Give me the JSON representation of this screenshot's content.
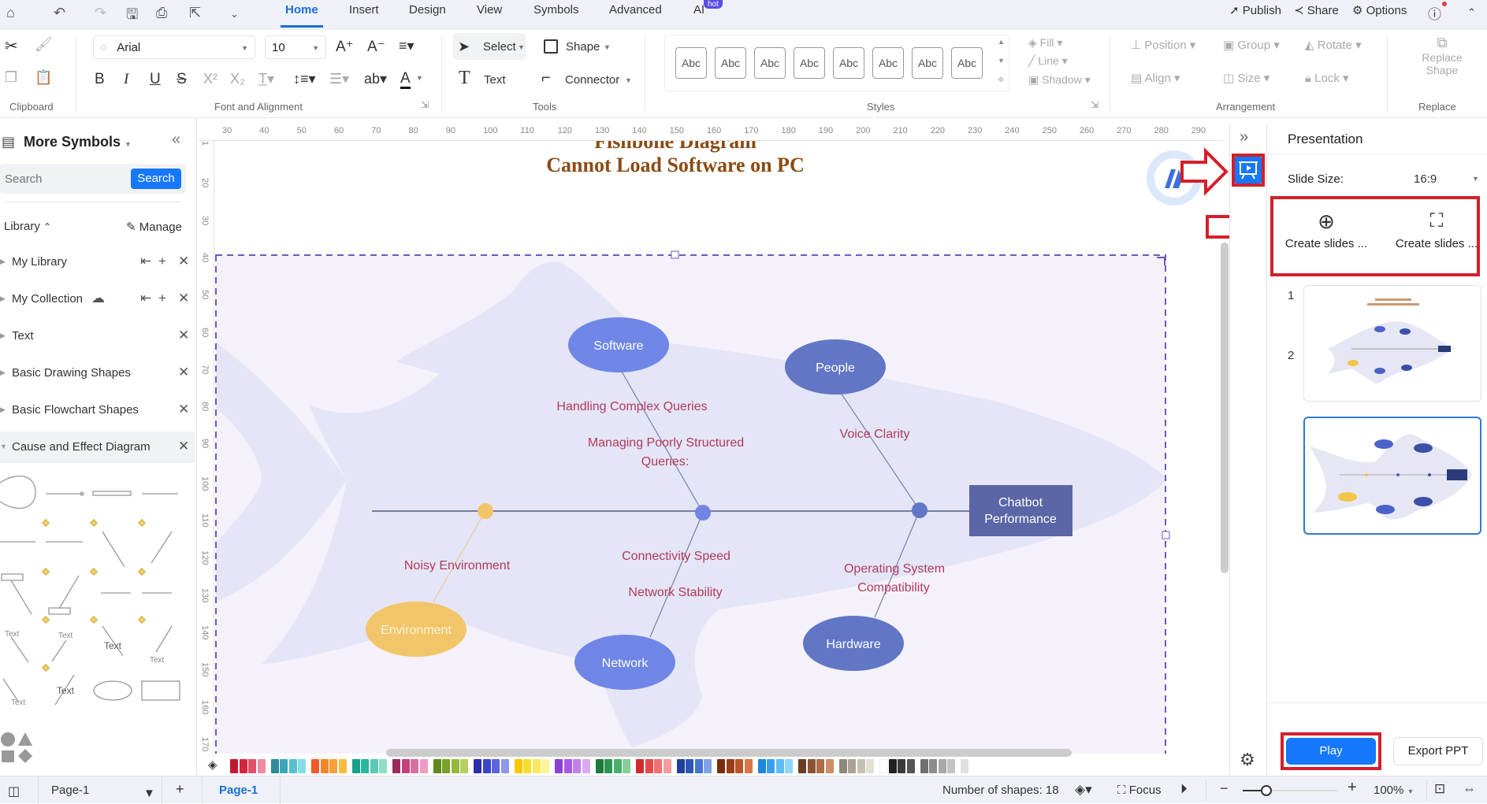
{
  "tabbar": {
    "tabs": [
      {
        "label": "Home",
        "active": true
      },
      {
        "label": "Insert"
      },
      {
        "label": "Design"
      },
      {
        "label": "View"
      },
      {
        "label": "Symbols"
      },
      {
        "label": "Advanced"
      },
      {
        "label": "AI",
        "badge": "hot"
      }
    ],
    "right": {
      "publish": "Publish",
      "share": "Share",
      "options": "Options"
    }
  },
  "ribbon": {
    "font_name": "Arial",
    "font_size": "10",
    "select": "Select",
    "shape": "Shape",
    "text": "Text",
    "connector": "Connector",
    "style_samples": [
      "Abc",
      "Abc",
      "Abc",
      "Abc",
      "Abc",
      "Abc",
      "Abc",
      "Abc"
    ],
    "fill": "Fill",
    "line": "Line",
    "shadow": "Shadow",
    "position": "Position",
    "group": "Group",
    "rotate": "Rotate",
    "align": "Align",
    "size": "Size",
    "lock": "Lock",
    "replace_shape_line1": "Replace",
    "replace_shape_line2": "Shape",
    "groups": {
      "clipboard": "Clipboard",
      "font": "Font and Alignment",
      "tools": "Tools",
      "styles": "Styles",
      "arrangement": "Arrangement",
      "replace": "Replace"
    },
    "bold": "B",
    "italic": "I",
    "underline": "U",
    "ab": "ab"
  },
  "sidebar": {
    "title": "More Symbols",
    "search_placeholder": "Search",
    "search_button": "Search",
    "library_label": "Library",
    "manage_label": "Manage",
    "items": [
      {
        "label": "My Library"
      },
      {
        "label": "My Collection"
      },
      {
        "label": "Text"
      },
      {
        "label": "Basic Drawing Shapes"
      },
      {
        "label": "Basic Flowchart Shapes"
      },
      {
        "label": "Cause and Effect Diagram",
        "expanded": true
      }
    ],
    "shape_text": "Text"
  },
  "ruler": {
    "top": [
      "30",
      "40",
      "50",
      "60",
      "70",
      "80",
      "90",
      "100",
      "110",
      "120",
      "130",
      "140",
      "150",
      "160",
      "170",
      "180",
      "190",
      "200",
      "210",
      "220",
      "230",
      "240",
      "250",
      "260",
      "270",
      "280",
      "290"
    ],
    "left": [
      "1",
      "20",
      "30",
      "40",
      "50",
      "60",
      "70",
      "80",
      "90",
      "100",
      "110",
      "120",
      "130",
      "140",
      "150",
      "160",
      "170"
    ]
  },
  "diagram": {
    "title_line1": "Fishbone Diagram",
    "title_line2": "Cannot Load Software on PC",
    "effect": {
      "line1": "Chatbot",
      "line2": "Performance"
    },
    "categories": {
      "software": "Software",
      "people": "People",
      "environment": "Environment",
      "network": "Network",
      "hardware": "Hardware"
    },
    "causes": {
      "handling": "Handling Complex Queries",
      "managing1": "Managing Poorly Structured",
      "managing2": "Queries:",
      "voice": "Voice Clarity",
      "noisy": "Noisy Environment",
      "connectivity": "Connectivity Speed",
      "stability": "Network Stability",
      "os1": "Operating System",
      "os2": "Compatibility"
    },
    "colors": {
      "ellipse_blue": "#6f86e6",
      "ellipse_dark": "#6176c5",
      "ellipse_yellow": "#f3c56a",
      "effect_box": "#5a66a6",
      "cause_text": "#b33a5a",
      "title": "#8b4a12",
      "fish": "#e4e5f7",
      "bg": "#f5f1fb"
    }
  },
  "palette": [
    "#c0182e",
    "#d62440",
    "#e35069",
    "#f08aa0",
    "#2f8a9c",
    "#3aa7bc",
    "#55c1d3",
    "#86dbe6",
    "#f05a28",
    "#f6842a",
    "#f9a03a",
    "#fbbc3f",
    "#16a08a",
    "#2bb79f",
    "#5acab3",
    "#8fddc9",
    "#9b2a5c",
    "#c2427b",
    "#d96ea0",
    "#ef9cc4",
    "#5e8a1c",
    "#78a02a",
    "#95b83b",
    "#b5cf60",
    "#2b2fa8",
    "#3b45c9",
    "#5b66dc",
    "#8f98eb",
    "#f7c800",
    "#fadd2a",
    "#fbe95b",
    "#fdf39b",
    "#8f3fd1",
    "#a75ae0",
    "#c280ea",
    "#d9a9f3",
    "#1d7a3a",
    "#2c9550",
    "#47ae6b",
    "#86cf9d",
    "#d12b2b",
    "#e34a4a",
    "#ef7070",
    "#f49b9b",
    "#1e3f9a",
    "#2c56b8",
    "#4776d0",
    "#7fa3e6",
    "#7a2d0c",
    "#983e18",
    "#b6572b",
    "#d7794b",
    "#1f86d9",
    "#3aa0ea",
    "#5cbcf3",
    "#8dd7fa",
    "#6b3d22",
    "#8c5333",
    "#ac6c48",
    "#cf8e66",
    "#8f877a",
    "#aaa394",
    "#c6c0b2",
    "#e3dfd3",
    "#ffffff",
    "#222222",
    "#3a3a3a",
    "#555555",
    "#707070",
    "#8c8c8c",
    "#a8a8a8",
    "#c4c4c4",
    "#e0e0e0"
  ],
  "status": {
    "page_selector": "Page-1",
    "page_tab": "Page-1",
    "shape_count": "Number of shapes: 18",
    "focus": "Focus",
    "zoom": "100%",
    "zoom_fraction": 0.25
  },
  "presentation": {
    "title": "Presentation",
    "slide_size_label": "Slide Size:",
    "slide_size_value": "16:9",
    "create_slides_1": "Create slides ...",
    "create_slides_2": "Create slides ...",
    "slides": [
      {
        "number": "1"
      },
      {
        "number": "2",
        "selected": true
      }
    ],
    "play": "Play",
    "export": "Export PPT"
  }
}
